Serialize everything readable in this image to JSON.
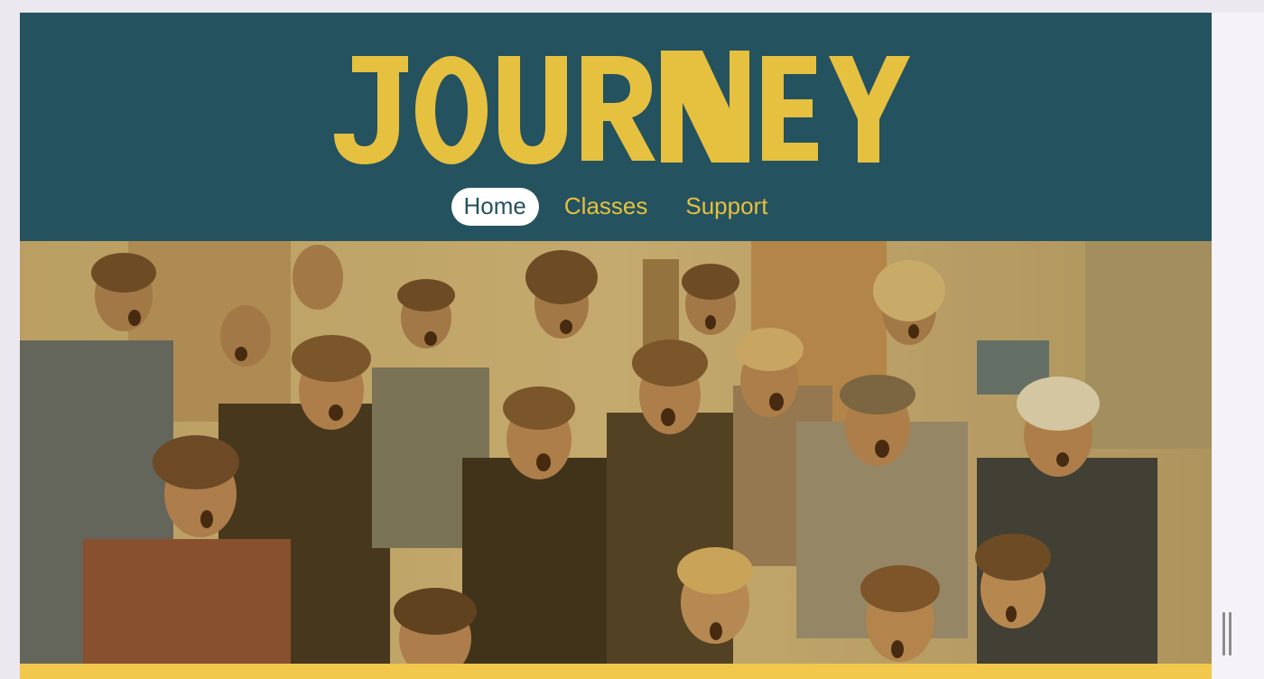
{
  "brand": {
    "title": "JOURNEY",
    "logo_color": "#e6c03f",
    "header_bg": "#25525f"
  },
  "nav": {
    "items": [
      {
        "label": "Home",
        "active": true
      },
      {
        "label": "Classes",
        "active": false
      },
      {
        "label": "Support",
        "active": false
      }
    ]
  },
  "hero": {
    "icon": "group-photo-image",
    "tint": "#c9a13a"
  },
  "footer_band": {
    "color": "#f1c84b"
  }
}
